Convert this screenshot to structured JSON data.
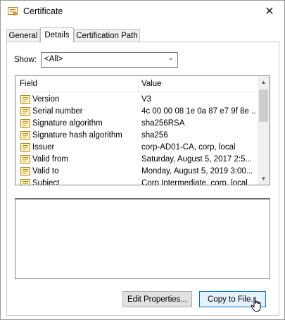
{
  "window": {
    "title": "Certificate",
    "close_label": "✕"
  },
  "tabs": [
    {
      "label": "General",
      "active": false
    },
    {
      "label": "Details",
      "active": true
    },
    {
      "label": "Certification Path",
      "active": false
    }
  ],
  "show": {
    "label": "Show:",
    "selected": "<All>"
  },
  "list": {
    "columns": [
      "Field",
      "Value"
    ],
    "rows": [
      {
        "field": "Version",
        "value": "V3"
      },
      {
        "field": "Serial number",
        "value": "4c 00 00 08 1e 0a 87 e7 9f 8e ..."
      },
      {
        "field": "Signature algorithm",
        "value": "sha256RSA"
      },
      {
        "field": "Signature hash algorithm",
        "value": "sha256"
      },
      {
        "field": "Issuer",
        "value": "corp-AD01-CA, corp, local"
      },
      {
        "field": "Valid from",
        "value": "Saturday, August 5, 2017 2:5..."
      },
      {
        "field": "Valid to",
        "value": "Monday, August 5, 2019 3:00..."
      },
      {
        "field": "Subject",
        "value": "Corp Intermediate, corp, local"
      }
    ]
  },
  "buttons": {
    "edit_properties": "Edit Properties...",
    "copy_to_file": "Copy to File..."
  },
  "colors": {
    "accent": "#0078d7",
    "icon_gold": "#c9a227"
  }
}
